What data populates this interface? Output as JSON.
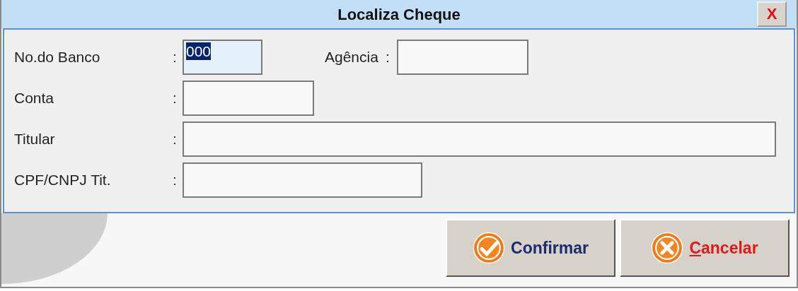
{
  "window": {
    "title": "Localiza Cheque",
    "close_label": "X"
  },
  "fields": [
    {
      "label": "No.do Banco",
      "separator": ":",
      "value": "000",
      "text_selected": true,
      "extra": {
        "label": "Agência",
        "separator": ":"
      }
    },
    {
      "label": "Conta",
      "separator": ":",
      "text_selected": false
    },
    {
      "label": "Titular",
      "separator": ":",
      "text_selected": false
    },
    {
      "label": "CPF/CNPJ Tit.",
      "separator": ":",
      "text_selected": false
    }
  ],
  "buttons": [
    {
      "kind": "confirm",
      "label": "Confirmar",
      "access_key_underlined": false
    },
    {
      "kind": "cancel",
      "label": "Cancelar",
      "access_key_underlined": true
    }
  ]
}
